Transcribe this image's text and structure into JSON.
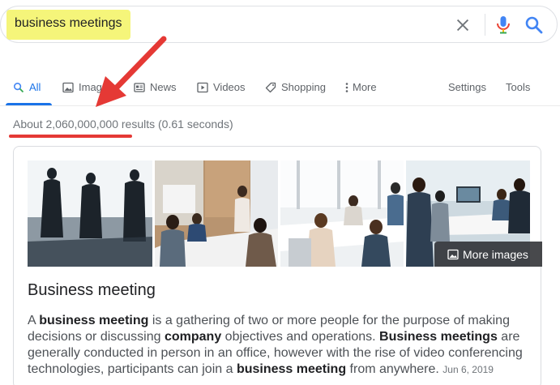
{
  "search": {
    "query": "business meetings"
  },
  "tabs": [
    {
      "label": "All",
      "icon": "search-icon",
      "active": true
    },
    {
      "label": "Images",
      "icon": "image-icon",
      "active": false
    },
    {
      "label": "News",
      "icon": "news-icon",
      "active": false
    },
    {
      "label": "Videos",
      "icon": "video-icon",
      "active": false
    },
    {
      "label": "Shopping",
      "icon": "tag-icon",
      "active": false
    },
    {
      "label": "More",
      "icon": "more-vert-icon",
      "active": false
    }
  ],
  "tools": {
    "settings_label": "Settings",
    "tools_label": "Tools"
  },
  "results": {
    "stats": "About 2,060,000,000 results (0.61 seconds)"
  },
  "knowledge_card": {
    "more_images_label": "More images",
    "title": "Business meeting",
    "description": [
      {
        "text": "A ",
        "bold": false
      },
      {
        "text": "business meeting",
        "bold": true
      },
      {
        "text": " is a gathering of two or more people for the purpose of making decisions or discussing ",
        "bold": false
      },
      {
        "text": "company",
        "bold": true
      },
      {
        "text": " objectives and operations. ",
        "bold": false
      },
      {
        "text": "Business meetings",
        "bold": true
      },
      {
        "text": " are generally conducted in person in an office, however with the rise of video conferencing technologies, participants can join a ",
        "bold": false
      },
      {
        "text": "business meeting",
        "bold": true
      },
      {
        "text": " from anywhere.",
        "bold": false
      }
    ],
    "date": "Jun 6, 2019"
  },
  "colors": {
    "accent": "#1a73e8",
    "annotation_red": "#e53935",
    "highlight_yellow": "#f5f57a"
  }
}
